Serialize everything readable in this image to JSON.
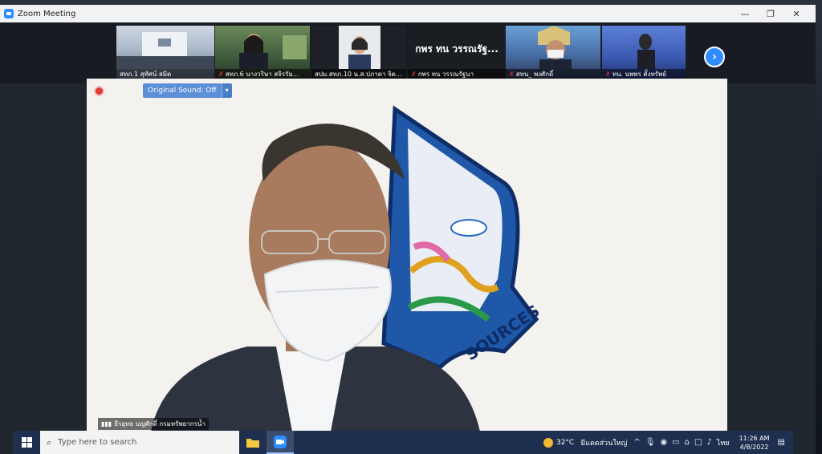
{
  "window": {
    "title": "Zoom Meeting",
    "min": "—",
    "max": "❐",
    "close": "✕"
  },
  "participants": [
    {
      "name": "สทภ.1 สุทัศน์ สมิต",
      "muted": false
    },
    {
      "name": "สทภ.6 นางวริษา สจิรรัม...",
      "muted": true
    },
    {
      "name": "สปม.สทภ.10 น.ส.ปภาดา จิต...",
      "muted": false
    },
    {
      "name": "กพร ทน วรรณรัฐนา",
      "muted": true,
      "big_label": "กพร ทน วรรณรัฐ..."
    },
    {
      "name": "สทน_ พงศักดิ์",
      "muted": true
    },
    {
      "name": "ทน. นพพร ตั้งทรัพย์",
      "muted": true
    }
  ],
  "main_video": {
    "original_sound_label": "Original Sound: Off",
    "dropdown_arrow": "▾",
    "speaker_name": "ธีรยุทธ บญศักดิ์ กรมทรัพยากรน้ำ",
    "logo_text": "SOURCES"
  },
  "taskbar": {
    "search_placeholder": "Type here to search",
    "weather_temp": "32°C",
    "weather_desc": "มีแดดส่วนใหญ่",
    "language": "ไทย",
    "time": "11:26 AM",
    "date": "4/8/2022"
  }
}
